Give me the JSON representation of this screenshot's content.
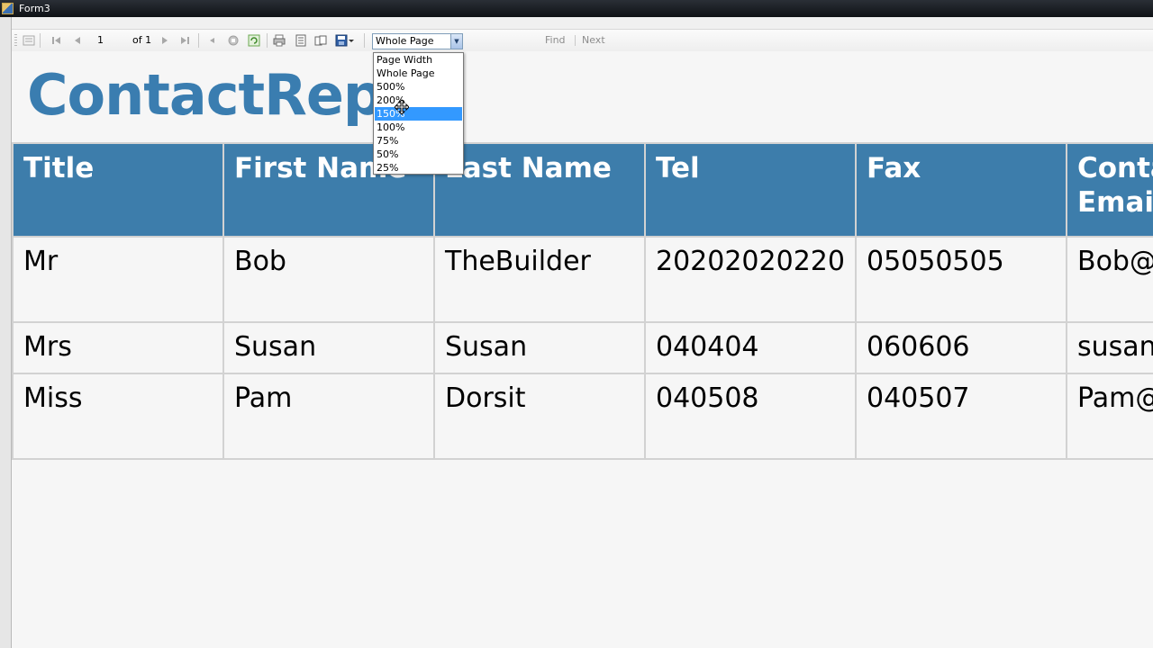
{
  "window": {
    "title": "Form3"
  },
  "toolbar": {
    "page_current": "1",
    "page_of": "of 1",
    "zoom_value": "Whole Page",
    "find_label": "Find",
    "next_label": "Next"
  },
  "report": {
    "title": "ContactRepo",
    "columns": [
      "Title",
      "First Name",
      "Last Name",
      "Tel",
      "Fax",
      "Contact Email"
    ],
    "rows": [
      [
        "Mr",
        "Bob",
        "TheBuilder",
        "20202020220",
        "05050505",
        "Bob@building"
      ],
      [
        "Mrs",
        "Susan",
        "Susan",
        "040404",
        "060606",
        "susan"
      ],
      [
        "Miss",
        "Pam",
        "Dorsit",
        "040508",
        "040507",
        "Pam@com"
      ]
    ]
  },
  "zoom_dropdown": {
    "options": [
      "Page Width",
      "Whole Page",
      "500%",
      "200%",
      "150%",
      "100%",
      "75%",
      "50%",
      "25%"
    ],
    "highlighted": "150%"
  },
  "colors": {
    "header_bg": "#3d7dab",
    "title_color": "#3a7db0",
    "highlight": "#3399ff",
    "cursor_halo": "#fff528"
  }
}
